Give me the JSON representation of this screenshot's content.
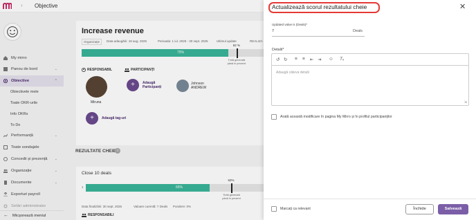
{
  "app": {
    "breadcrumb": "Objective"
  },
  "sidebar": {
    "items": [
      {
        "label": "My mirro"
      },
      {
        "label": "Panou de bord"
      },
      {
        "label": "Obiective"
      },
      {
        "label": "Performanță"
      },
      {
        "label": "Toate sondajele"
      },
      {
        "label": "Concedii și prezență"
      },
      {
        "label": "Organizație"
      },
      {
        "label": "Documente"
      },
      {
        "label": "Exporturi payroll"
      },
      {
        "label": "Setări administrator"
      }
    ],
    "sub_items": [
      {
        "label": "Obiectivele mele"
      },
      {
        "label": "Toate OKR-urile"
      },
      {
        "label": "Info OKRs"
      },
      {
        "label": "To Do"
      }
    ],
    "minimize_label": "Micșorează meniul"
  },
  "objective": {
    "title": "Increase revenue",
    "tag": "Organizație",
    "date_added": "Data adaugării: 18 aug. 2025",
    "period": "Perioada: 1 iul. 2025 - 30 sept. 2025",
    "last_update": "Ultimul update",
    "realized": "REALIZA",
    "progress_label": "75%",
    "progress": 0.75,
    "target_label": "62 %",
    "target": 0.62,
    "target_text": "Țintă generată până în prezent",
    "responsible_title": "RESPONSABIL",
    "participants_title": "PARTICIPANȚI",
    "responsible_name": "Miruna",
    "add_participants": "Adaugă Participanți",
    "participant_name_1": "Johnson",
    "participant_name_2": "ANDREW",
    "add_tags": "Adaugă tag-uri"
  },
  "key_results": {
    "title": "REZULTATE CHEIE",
    "item_title": "Close 10 deals",
    "bar_start": "1",
    "progress_label": "65%",
    "progress": 0.65,
    "target_label": "62%",
    "target": 0.62,
    "target_text": "Țintă generată până în prezent",
    "finish_date": "Data finalizării: 30 sept. 2025",
    "current_value": "Valoare curentă: 7 Deals",
    "weight": "Pondere: 0%",
    "responsible_title": "RESPONSABILI"
  },
  "panel": {
    "title": "Actualizează scorul rezultatului cheie",
    "updated_value_label": "Updated value is (Deals)*",
    "updated_value": "7",
    "unit": "Deals",
    "details_label": "Detalii*",
    "details_placeholder": "Adaugă câteva detalii",
    "show_change_label": "Arată această modificare în pagina My Mirro și în profilul participanților",
    "mark_relevant_label": "Marcați ca relevant",
    "close_label": "Închide",
    "save_label": "Salvează"
  },
  "colors": {
    "accent": "#7b5ea7",
    "progress": "#3ab59a",
    "highlight": "#e53935"
  }
}
